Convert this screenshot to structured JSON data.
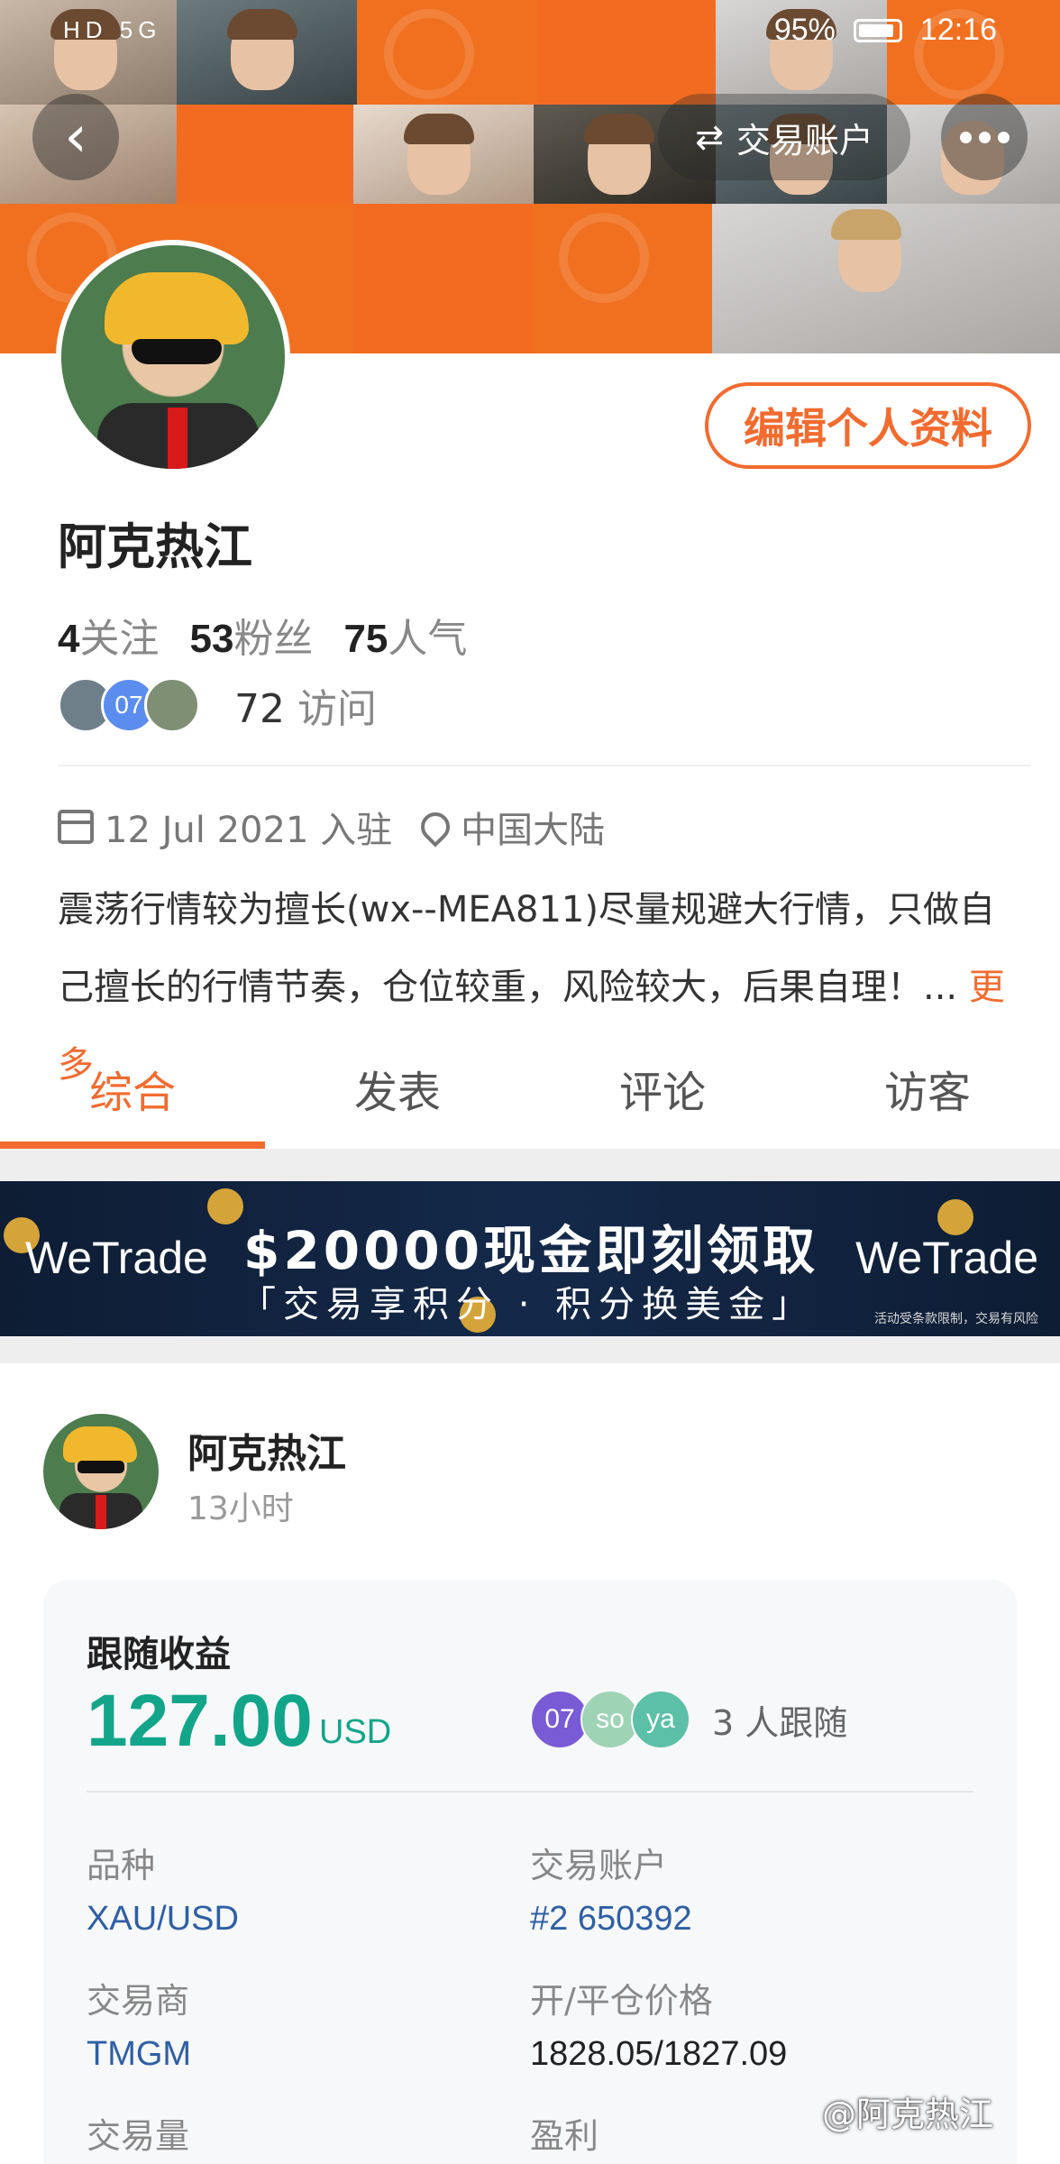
{
  "status_bar": {
    "left": "HD 5G",
    "battery": "95%",
    "time": "12:16"
  },
  "header": {
    "account_label": "交易账户",
    "edit_label": "编辑个人资料"
  },
  "profile": {
    "name": "阿克热江",
    "following_count": "4",
    "following_label": "关注",
    "fans_count": "53",
    "fans_label": "粉丝",
    "popularity_count": "75",
    "popularity_label": "人气",
    "visitor_avatars": [
      {
        "text": "",
        "color": "#6f7f8a"
      },
      {
        "text": "07",
        "color": "#5b8def"
      },
      {
        "text": "",
        "color": "#7e8f74"
      }
    ],
    "visits_count": "72",
    "visits_label": "访问",
    "join_date": "12 Jul 2021 入驻",
    "location": "中国大陆",
    "bio": "震荡行情较为擅长(wx--MEA811)尽量规避大行情，只做自己擅长的行情节奏，仓位较重，风险较大，后果自理！...",
    "more_label": "更多"
  },
  "tabs": [
    {
      "label": "综合",
      "active": true
    },
    {
      "label": "发表",
      "active": false
    },
    {
      "label": "评论",
      "active": false
    },
    {
      "label": "访客",
      "active": false
    }
  ],
  "promo": {
    "brand": "WeTrade",
    "headline": "$20000现金即刻领取",
    "subline": "「交易享积分 · 积分换美金」",
    "disclaimer": "活动受条款限制，交易有风险"
  },
  "post": {
    "author": "阿克热江",
    "time": "13小时",
    "card": {
      "title": "跟随收益",
      "profit": "127.00",
      "unit": "USD",
      "followers": [
        {
          "text": "07",
          "color": "#7a5bd6"
        },
        {
          "text": "so",
          "color": "#9fd3b5"
        },
        {
          "text": "ya",
          "color": "#5cc0a8"
        }
      ],
      "followers_text": "3 人跟随",
      "fields": {
        "symbol_label": "品种",
        "symbol": "XAU/USD",
        "account_label": "交易账户",
        "account": "#2 650392",
        "broker_label": "交易商",
        "broker": "TMGM",
        "price_label": "开/平仓价格",
        "price": "1828.05/1827.09",
        "volume_label": "交易量",
        "pnl_label": "盈利"
      }
    }
  },
  "watermark": "@阿克热江",
  "colors": {
    "accent": "#f26b2f",
    "profit_green": "#12a58a",
    "link_blue": "#2e5fa3"
  }
}
